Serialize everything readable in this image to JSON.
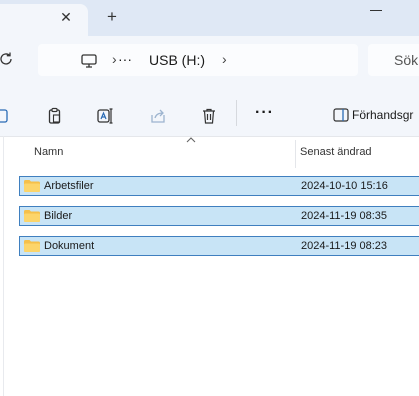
{
  "tabs": {
    "close_symbol": "✕",
    "add_symbol": "+"
  },
  "address": {
    "separator": "›",
    "more_symbol": "···",
    "drive": "USB (H:)",
    "search_placeholder": "Sök i"
  },
  "toolbar": {
    "more_symbol": "···",
    "preview_label": "Förhandsgr"
  },
  "columns": {
    "name": "Namn",
    "modified": "Senast ändrad"
  },
  "files": [
    {
      "name": "Arbetsfiler",
      "modified": "2024-10-10 15:16"
    },
    {
      "name": "Bilder",
      "modified": "2024-11-19 08:35"
    },
    {
      "name": "Dokument",
      "modified": "2024-11-19 08:23"
    }
  ],
  "colors": {
    "selection_fill": "#c8e4f6",
    "selection_border": "#3f7fbf",
    "folder": "#f5c04a"
  },
  "icons": [
    "refresh-icon",
    "computer-icon",
    "cut-icon",
    "paste-icon",
    "rename-icon",
    "share-icon",
    "delete-icon",
    "preview-pane-icon",
    "folder-icon",
    "sort-ascending-icon"
  ]
}
